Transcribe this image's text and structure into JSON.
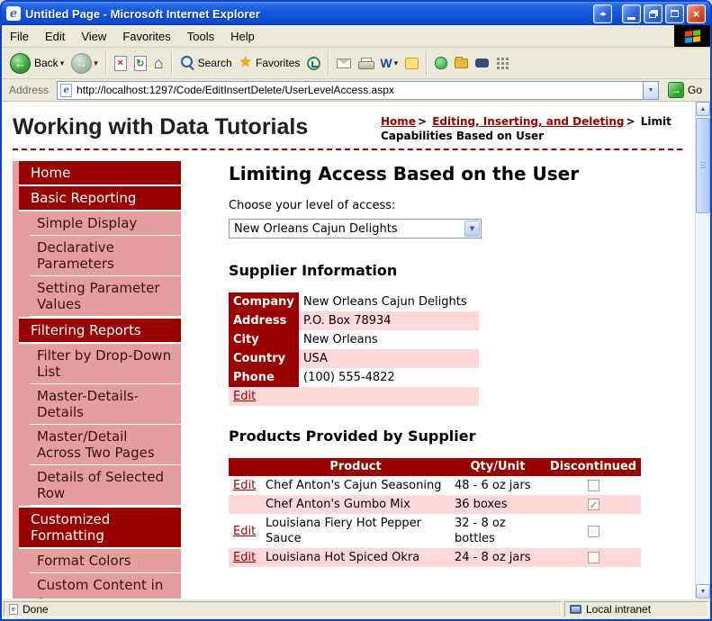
{
  "window": {
    "title": "Untitled Page - Microsoft Internet Explorer",
    "ie_glyph": "e",
    "fullscreen_glyph": "◂▸",
    "close_glyph": "×"
  },
  "menu": {
    "items": [
      "File",
      "Edit",
      "View",
      "Favorites",
      "Tools",
      "Help"
    ]
  },
  "toolbar": {
    "back_label": "Back",
    "search_label": "Search",
    "favorites_label": "Favorites",
    "glyphs": {
      "back": "←",
      "forward": "→",
      "stop": "×",
      "refresh": "↻",
      "home": "⌂",
      "star": "★",
      "word": "W",
      "chevron": "▾"
    }
  },
  "address": {
    "label": "Address",
    "url": "http://localhost:1297/Code/EditInsertDelete/UserLevelAccess.aspx",
    "go": "Go",
    "go_glyph": "→",
    "drop_glyph": "▼",
    "ie_glyph": "e"
  },
  "scrollbar": {
    "up": "▲",
    "down": "▼"
  },
  "status": {
    "done": "Done",
    "zone": "Local intranet",
    "doc_glyph": "e"
  },
  "page": {
    "site_title": "Working with Data Tutorials",
    "breadcrumb": {
      "home": "Home",
      "sep1": ">",
      "section": "Editing, Inserting, and Deleting",
      "sep2": ">",
      "current": "Limit Capabilities Based on User"
    },
    "sidebar": [
      {
        "label": "Home",
        "level": 1
      },
      {
        "label": "Basic Reporting",
        "level": 1
      },
      {
        "label": "Simple Display",
        "level": 2
      },
      {
        "label": "Declarative Parameters",
        "level": 2
      },
      {
        "label": "Setting Parameter Values",
        "level": 2
      },
      {
        "label": "Filtering Reports",
        "level": 1
      },
      {
        "label": "Filter by Drop-Down List",
        "level": 2
      },
      {
        "label": "Master-Details-Details",
        "level": 2
      },
      {
        "label": "Master/Detail Across Two Pages",
        "level": 2
      },
      {
        "label": "Details of Selected Row",
        "level": 2
      },
      {
        "label": "Customized Formatting",
        "level": 1
      },
      {
        "label": "Format Colors",
        "level": 2
      },
      {
        "label": "Custom Content in a",
        "level": 2
      }
    ],
    "heading": "Limiting Access Based on the User",
    "access_label": "Choose your level of access:",
    "access_value": "New Orleans Cajun Delights",
    "drop_glyph": "▼",
    "supplier_heading": "Supplier Information",
    "supplier_rows": [
      {
        "label": "Company",
        "value": "New Orleans Cajun Delights"
      },
      {
        "label": "Address",
        "value": "P.O. Box 78934"
      },
      {
        "label": "City",
        "value": "New Orleans"
      },
      {
        "label": "Country",
        "value": "USA"
      },
      {
        "label": "Phone",
        "value": "(100) 555-4822"
      }
    ],
    "supplier_edit": "Edit",
    "products_heading": "Products Provided by Supplier",
    "products_columns": [
      "",
      "Product",
      "Qty/Unit",
      "Discontinued"
    ],
    "products_rows": [
      {
        "edit": "Edit",
        "product": "Chef Anton's Cajun Seasoning",
        "qty": "48 - 6 oz jars",
        "discontinued": false
      },
      {
        "edit": "",
        "product": "Chef Anton's Gumbo Mix",
        "qty": "36 boxes",
        "discontinued": true
      },
      {
        "edit": "Edit",
        "product": "Louisiana Fiery Hot Pepper Sauce",
        "qty": "32 - 8 oz bottles",
        "discontinued": false
      },
      {
        "edit": "Edit",
        "product": "Louisiana Hot Spiced Okra",
        "qty": "24 - 8 oz jars",
        "discontinued": false
      }
    ]
  },
  "colors": {
    "maroon": "#990000",
    "sidebar_pink": "#E49E9E",
    "row_pink": "#FFD9D9",
    "titlebar_blue": "#1356DC"
  }
}
